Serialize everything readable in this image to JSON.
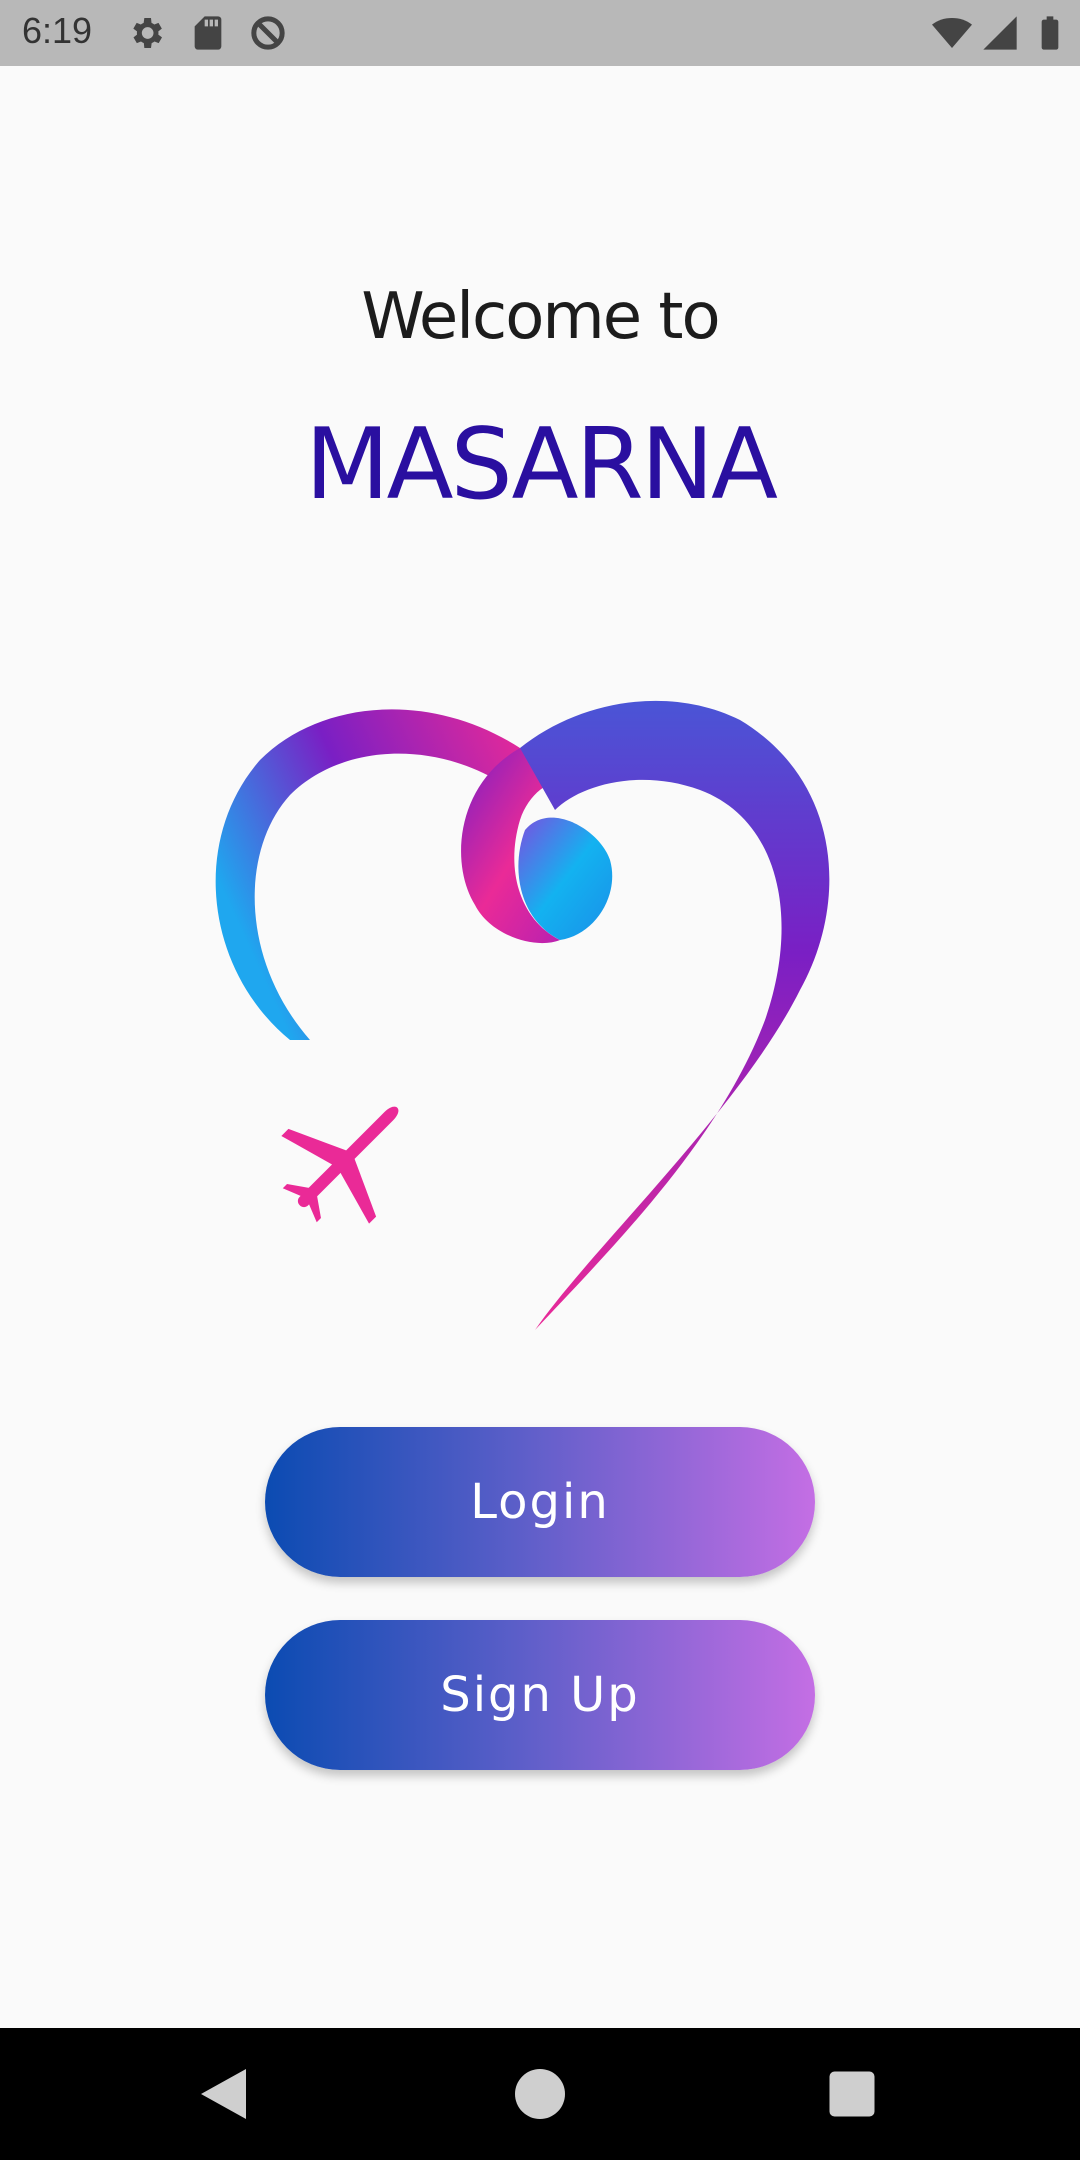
{
  "status_bar": {
    "time": "6:19",
    "left_icons": [
      "gear-icon",
      "sd-card-icon",
      "no-sync-icon"
    ],
    "right_icons": [
      "wifi-icon",
      "signal-icon",
      "battery-icon"
    ]
  },
  "welcome": {
    "line1": "Welcome to",
    "app_name": "MASARNA"
  },
  "logo": {
    "icon": "heart-airplane-logo-icon",
    "colors": {
      "blue": "#1fa7ef",
      "purple": "#7a1fc4",
      "pink": "#e92a97"
    }
  },
  "buttons": {
    "login": "Login",
    "signup": "Sign Up"
  },
  "nav_bar": {
    "back": "back-icon",
    "home": "home-icon",
    "recents": "recents-icon"
  },
  "theme": {
    "accent_start": "#0b4bb2",
    "accent_end": "#c46ee4",
    "title_color": "#2a0fa0"
  }
}
